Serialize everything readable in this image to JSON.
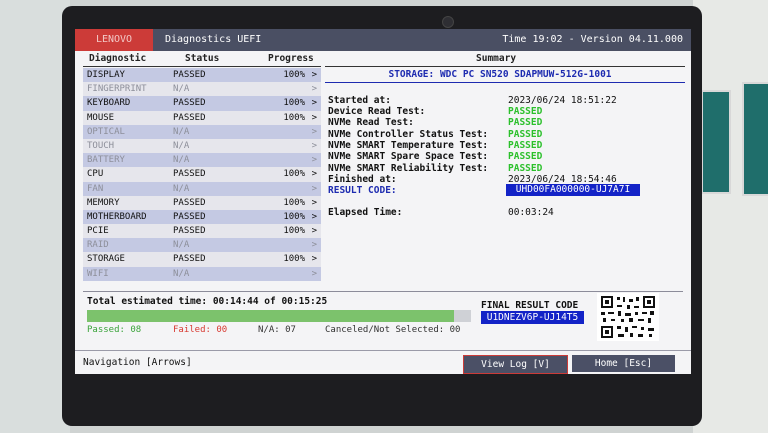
{
  "brand": "LENOVO",
  "app_title": "Diagnostics UEFI",
  "time_version": "Time 19:02 - Version 04.11.000",
  "headers": {
    "diagnostic": "Diagnostic",
    "status": "Status",
    "progress": "Progress",
    "summary": "Summary"
  },
  "diagnostics": [
    {
      "name": "DISPLAY",
      "status": "PASSED",
      "progress": "100%",
      "arrow": ">",
      "available": true
    },
    {
      "name": "FINGERPRINT",
      "status": "N/A",
      "progress": "",
      "arrow": ">",
      "available": false
    },
    {
      "name": "KEYBOARD",
      "status": "PASSED",
      "progress": "100%",
      "arrow": ">",
      "available": true
    },
    {
      "name": "MOUSE",
      "status": "PASSED",
      "progress": "100%",
      "arrow": ">",
      "available": true
    },
    {
      "name": "OPTICAL",
      "status": "N/A",
      "progress": "",
      "arrow": ">",
      "available": false
    },
    {
      "name": "TOUCH",
      "status": "N/A",
      "progress": "",
      "arrow": ">",
      "available": false
    },
    {
      "name": "BATTERY",
      "status": "N/A",
      "progress": "",
      "arrow": ">",
      "available": false
    },
    {
      "name": "CPU",
      "status": "PASSED",
      "progress": "100%",
      "arrow": ">",
      "available": true
    },
    {
      "name": "FAN",
      "status": "N/A",
      "progress": "",
      "arrow": ">",
      "available": false
    },
    {
      "name": "MEMORY",
      "status": "PASSED",
      "progress": "100%",
      "arrow": ">",
      "available": true
    },
    {
      "name": "MOTHERBOARD",
      "status": "PASSED",
      "progress": "100%",
      "arrow": ">",
      "available": true
    },
    {
      "name": "PCIE",
      "status": "PASSED",
      "progress": "100%",
      "arrow": ">",
      "available": true
    },
    {
      "name": "RAID",
      "status": "N/A",
      "progress": "",
      "arrow": ">",
      "available": false
    },
    {
      "name": "STORAGE",
      "status": "PASSED",
      "progress": "100%",
      "arrow": ">",
      "available": true
    },
    {
      "name": "WIFI",
      "status": "N/A",
      "progress": "",
      "arrow": ">",
      "available": false
    }
  ],
  "summary": {
    "title": "STORAGE: WDC PC SN520 SDAPMUW-512G-1001",
    "started_label": "Started at:",
    "started_value": "2023/06/24 18:51:22",
    "tests": [
      {
        "label": "Device Read Test:",
        "result": "PASSED"
      },
      {
        "label": "NVMe Read Test:",
        "result": "PASSED"
      },
      {
        "label": "NVMe Controller Status Test:",
        "result": "PASSED"
      },
      {
        "label": "NVMe SMART Temperature Test:",
        "result": "PASSED"
      },
      {
        "label": "NVMe SMART Spare Space Test:",
        "result": "PASSED"
      },
      {
        "label": "NVMe SMART Reliability Test:",
        "result": "PASSED"
      }
    ],
    "finished_label": "Finished at:",
    "finished_value": "2023/06/24 18:54:46",
    "result_code_label": "RESULT CODE:",
    "result_code_value": "UHD00FA000000-UJ7A7I",
    "elapsed_label": "Elapsed Time:",
    "elapsed_value": "00:03:24"
  },
  "footer": {
    "total_time": "Total estimated time: 00:14:44 of 00:15:25",
    "progress_fraction": 0.955,
    "passed": "Passed: 08",
    "failed": "Failed: 00",
    "na": "N/A: 07",
    "canceled": "Canceled/Not Selected: 00",
    "final_label": "FINAL RESULT CODE",
    "final_code": "U1DNEZV6P-UJ14T5"
  },
  "navigation": {
    "hint": "Navigation [Arrows]",
    "view_log": "View Log [V]",
    "home": "Home [Esc]"
  },
  "colors": {
    "brand_red": "#cc3b38",
    "title_bar": "#4a4f63",
    "pass_green": "#2bc02b",
    "code_blue": "#1323c7",
    "fail_red": "#d83a32"
  }
}
